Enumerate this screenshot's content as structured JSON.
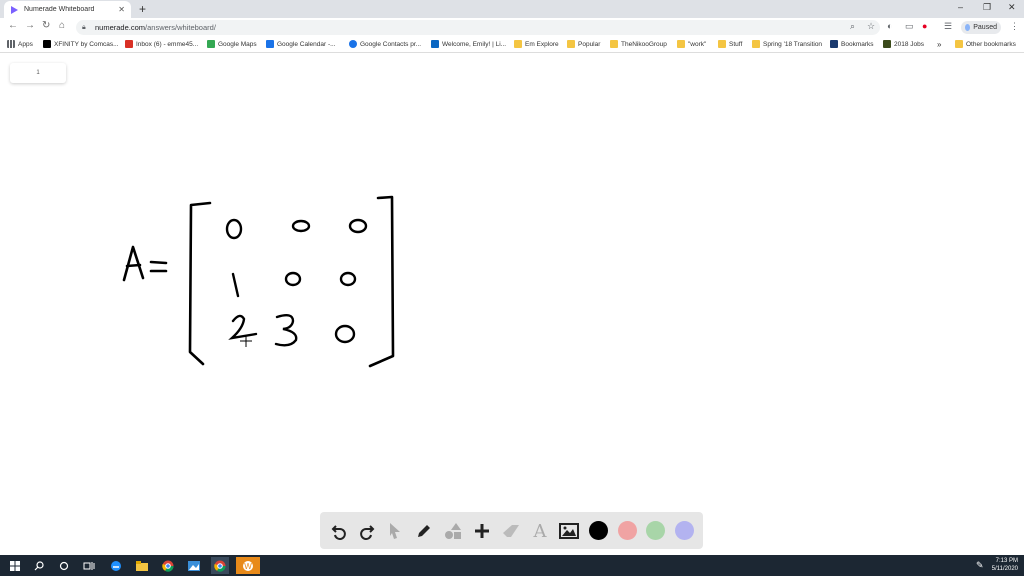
{
  "browser": {
    "tab_title": "Numerade Whiteboard",
    "new_tab_icon": "plus",
    "url_host": "numerade.com",
    "url_path": "/answers/whiteboard/",
    "paused_label": "Paused"
  },
  "bookmarks": [
    {
      "label": "Apps",
      "color": "#5f6368"
    },
    {
      "label": "XFINITY by Comcas...",
      "color": "#000000"
    },
    {
      "label": "Inbox (6) - emme45...",
      "color": "#d93025"
    },
    {
      "label": "Google Maps",
      "color": "#34a853"
    },
    {
      "label": "Google Calendar -...",
      "color": "#1a73e8"
    },
    {
      "label": "Google Contacts pr...",
      "color": "#1a73e8"
    },
    {
      "label": "Welcome, Emily! | Li...",
      "color": "#0a66c2"
    },
    {
      "label": "Em Explore",
      "color": "#f4c542"
    },
    {
      "label": "Popular",
      "color": "#f4c542"
    },
    {
      "label": "TheNikooGroup",
      "color": "#f4c542"
    },
    {
      "label": "\"work\"",
      "color": "#f4c542"
    },
    {
      "label": "Stuff",
      "color": "#f4c542"
    },
    {
      "label": "Spring '18 Transition",
      "color": "#f4c542"
    },
    {
      "label": "Bookmarks",
      "color": "#1a3a6e"
    },
    {
      "label": "2018 Jobs",
      "color": "#3a4a1a"
    },
    {
      "label": "»",
      "color": ""
    },
    {
      "label": "Other bookmarks",
      "color": "#f4c542"
    }
  ],
  "whiteboard": {
    "page_number": "1",
    "matrix_label": "A=",
    "matrix_rows": [
      [
        "0",
        "0",
        "0"
      ],
      [
        "1",
        "0",
        "0"
      ],
      [
        "2",
        "3",
        "0"
      ]
    ],
    "colors": [
      "#000000",
      "#f0a3a3",
      "#a8d5a8",
      "#b3b3f0"
    ]
  },
  "taskbar": {
    "time": "7:13 PM",
    "date": "5/11/2020"
  }
}
